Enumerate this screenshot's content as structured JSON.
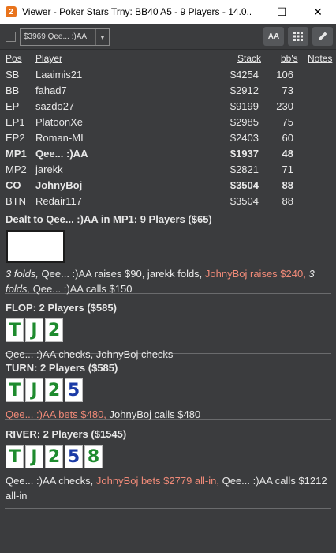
{
  "window": {
    "app_icon_text": "2",
    "title": "Viewer - Poker Stars Trny: BB40 A5 - 9 Players - 14.0...",
    "minimize": "—",
    "maximize": "☐",
    "close": "✕"
  },
  "toolbar": {
    "combo_value": "$3969 Qee... :)AA",
    "aa_label": "AA"
  },
  "table": {
    "headers": {
      "pos": "Pos",
      "player": "Player",
      "stack": "Stack",
      "bbs": "bb's",
      "notes": "Notes"
    },
    "rows": [
      {
        "pos": "SB",
        "player": "Laaimis21",
        "stack": "$4254",
        "bbs": "106"
      },
      {
        "pos": "BB",
        "player": "fahad7",
        "stack": "$2912",
        "bbs": "73"
      },
      {
        "pos": "EP",
        "player": "sazdo27",
        "stack": "$9199",
        "bbs": "230"
      },
      {
        "pos": "EP1",
        "player": "PlatoonXe",
        "stack": "$2985",
        "bbs": "75"
      },
      {
        "pos": "EP2",
        "player": "Roman-MI",
        "stack": "$2403",
        "bbs": "60"
      },
      {
        "pos": "MP1",
        "player": "Qee... :)AA",
        "stack": "$1937",
        "bbs": "48"
      },
      {
        "pos": "MP2",
        "player": "jarekk",
        "stack": "$2821",
        "bbs": "71"
      },
      {
        "pos": "CO",
        "player": "JohnyBoj",
        "stack": "$3504",
        "bbs": "88"
      },
      {
        "pos": "BTN",
        "player": "Redair117",
        "stack": "$3504",
        "bbs": "88"
      }
    ]
  },
  "preflop": {
    "title": "Dealt to Qee... :)AA in MP1: 9 Players ($65)",
    "a1": "3 folds,",
    "a2": " Qee... :)AA raises $90, jarekk folds, ",
    "a3": "JohnyBoj raises $240,",
    "a4": " 3 folds,",
    "a5": " Qee... :)AA calls $150"
  },
  "flop": {
    "title": "FLOP: 2 Players ($585)",
    "cards": [
      "T",
      "J",
      "2"
    ],
    "action": "Qee... :)AA checks, JohnyBoj checks"
  },
  "turn": {
    "title": "TURN: 2 Players ($585)",
    "cards": [
      "T",
      "J",
      "2",
      "5"
    ],
    "a1": "Qee... :)AA bets $480,",
    "a2": " JohnyBoj calls $480"
  },
  "river": {
    "title": "RIVER: 2 Players ($1545)",
    "cards": [
      "T",
      "J",
      "2",
      "5",
      "8"
    ],
    "a1": "Qee... :)AA checks, ",
    "a2": "JohnyBoj bets $2779 all-in,",
    "a3": " Qee... :)AA calls $1212 all-in"
  }
}
